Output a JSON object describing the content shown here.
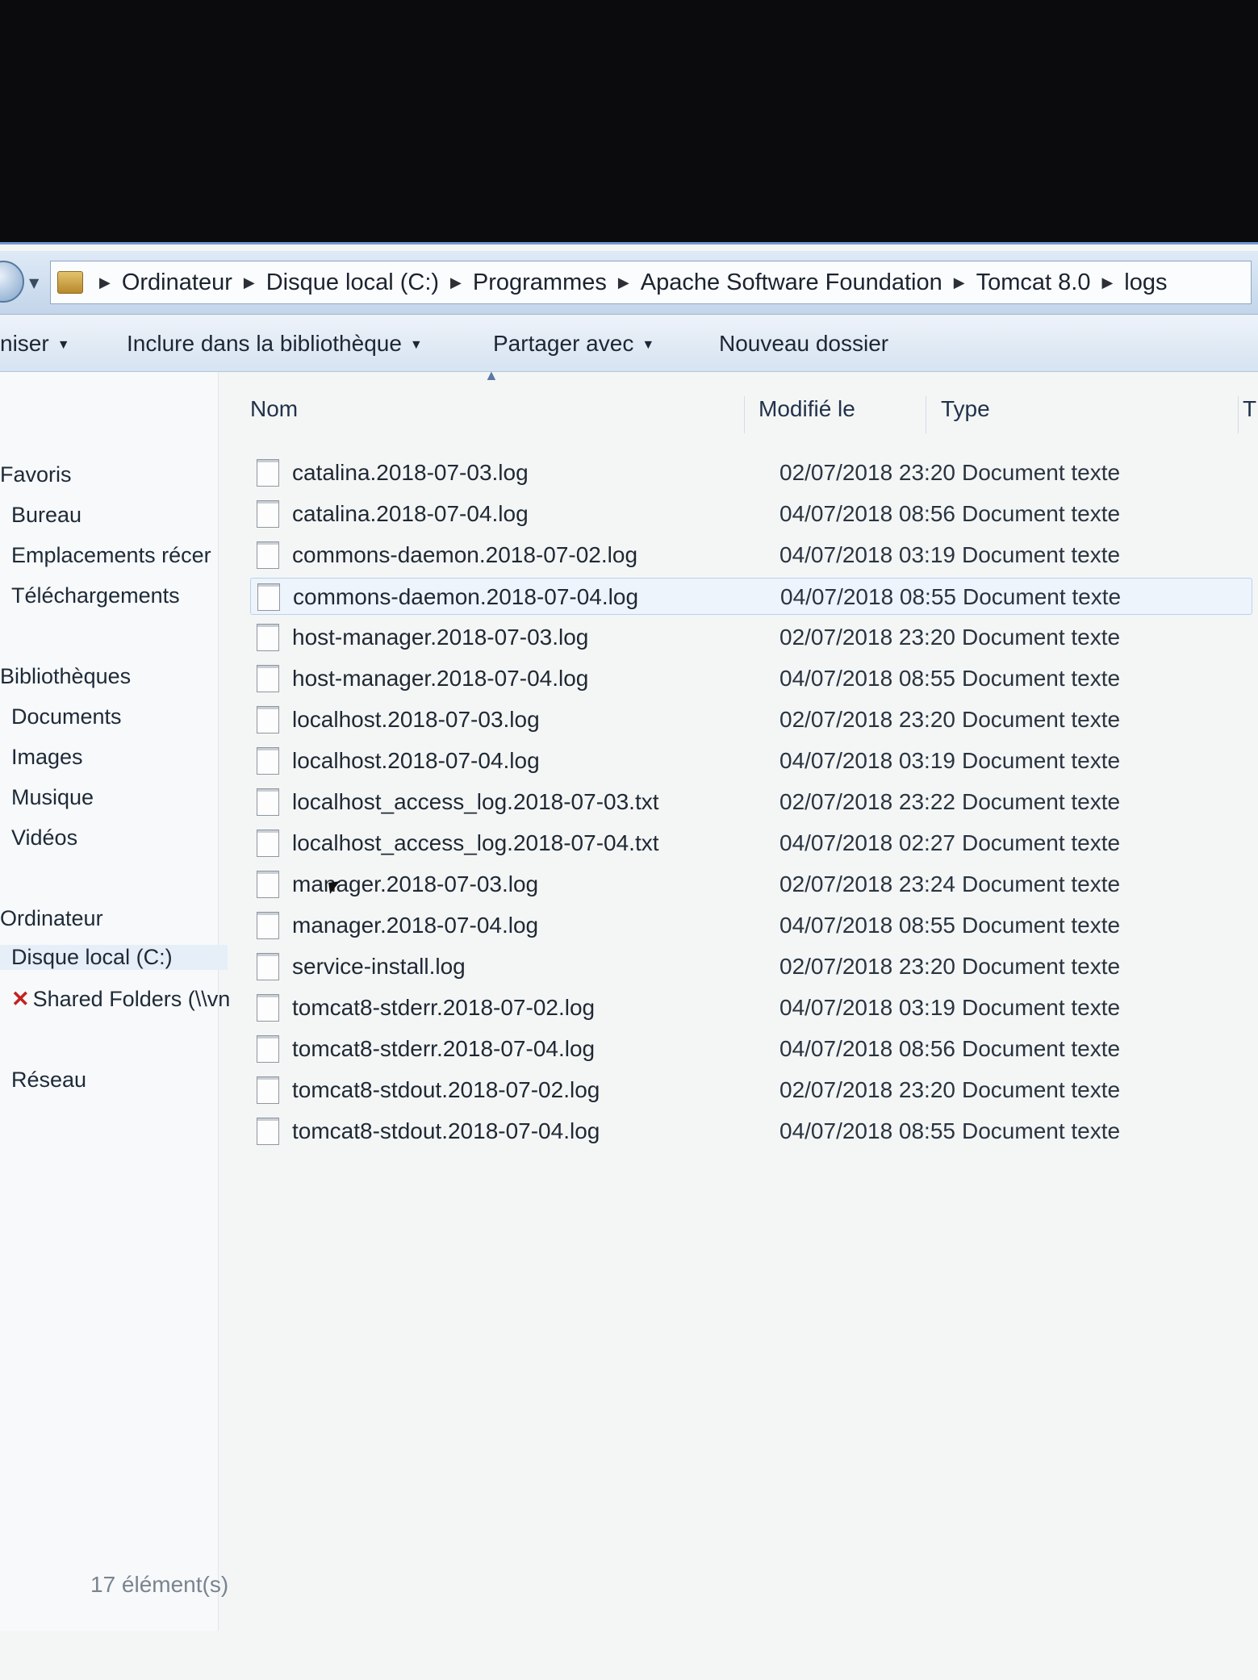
{
  "address": {
    "crumbs": [
      "Ordinateur",
      "Disque local (C:)",
      "Programmes",
      "Apache Software Foundation",
      "Tomcat 8.0",
      "logs"
    ]
  },
  "toolbar": {
    "organize": "niser",
    "include_library": "Inclure dans la bibliothèque",
    "share_with": "Partager avec",
    "new_folder": "Nouveau dossier"
  },
  "navpane": {
    "favorites": "Favoris",
    "desktop": "Bureau",
    "recent": "Emplacements récer",
    "downloads": "Téléchargements",
    "libraries": "Bibliothèques",
    "documents": "Documents",
    "images": "Images",
    "music": "Musique",
    "videos": "Vidéos",
    "computer": "Ordinateur",
    "local_disk": "Disque local (C:)",
    "shared_folders": "Shared Folders (\\\\vn",
    "network": "Réseau"
  },
  "columns": {
    "name": "Nom",
    "modified": "Modifié le",
    "type": "Type",
    "size": "T"
  },
  "files": [
    {
      "name": "catalina.2018-07-03.log",
      "date": "02/07/2018 23:20",
      "type": "Document texte"
    },
    {
      "name": "catalina.2018-07-04.log",
      "date": "04/07/2018 08:56",
      "type": "Document texte"
    },
    {
      "name": "commons-daemon.2018-07-02.log",
      "date": "04/07/2018 03:19",
      "type": "Document texte"
    },
    {
      "name": "commons-daemon.2018-07-04.log",
      "date": "04/07/2018 08:55",
      "type": "Document texte"
    },
    {
      "name": "host-manager.2018-07-03.log",
      "date": "02/07/2018 23:20",
      "type": "Document texte"
    },
    {
      "name": "host-manager.2018-07-04.log",
      "date": "04/07/2018 08:55",
      "type": "Document texte"
    },
    {
      "name": "localhost.2018-07-03.log",
      "date": "02/07/2018 23:20",
      "type": "Document texte"
    },
    {
      "name": "localhost.2018-07-04.log",
      "date": "04/07/2018 03:19",
      "type": "Document texte"
    },
    {
      "name": "localhost_access_log.2018-07-03.txt",
      "date": "02/07/2018 23:22",
      "type": "Document texte"
    },
    {
      "name": "localhost_access_log.2018-07-04.txt",
      "date": "04/07/2018 02:27",
      "type": "Document texte"
    },
    {
      "name": "manager.2018-07-03.log",
      "date": "02/07/2018 23:24",
      "type": "Document texte"
    },
    {
      "name": "manager.2018-07-04.log",
      "date": "04/07/2018 08:55",
      "type": "Document texte"
    },
    {
      "name": "service-install.log",
      "date": "02/07/2018 23:20",
      "type": "Document texte"
    },
    {
      "name": "tomcat8-stderr.2018-07-02.log",
      "date": "04/07/2018 03:19",
      "type": "Document texte"
    },
    {
      "name": "tomcat8-stderr.2018-07-04.log",
      "date": "04/07/2018 08:56",
      "type": "Document texte"
    },
    {
      "name": "tomcat8-stdout.2018-07-02.log",
      "date": "02/07/2018 23:20",
      "type": "Document texte"
    },
    {
      "name": "tomcat8-stdout.2018-07-04.log",
      "date": "04/07/2018 08:55",
      "type": "Document texte"
    }
  ],
  "status": {
    "item_count": "17 élément(s)"
  }
}
